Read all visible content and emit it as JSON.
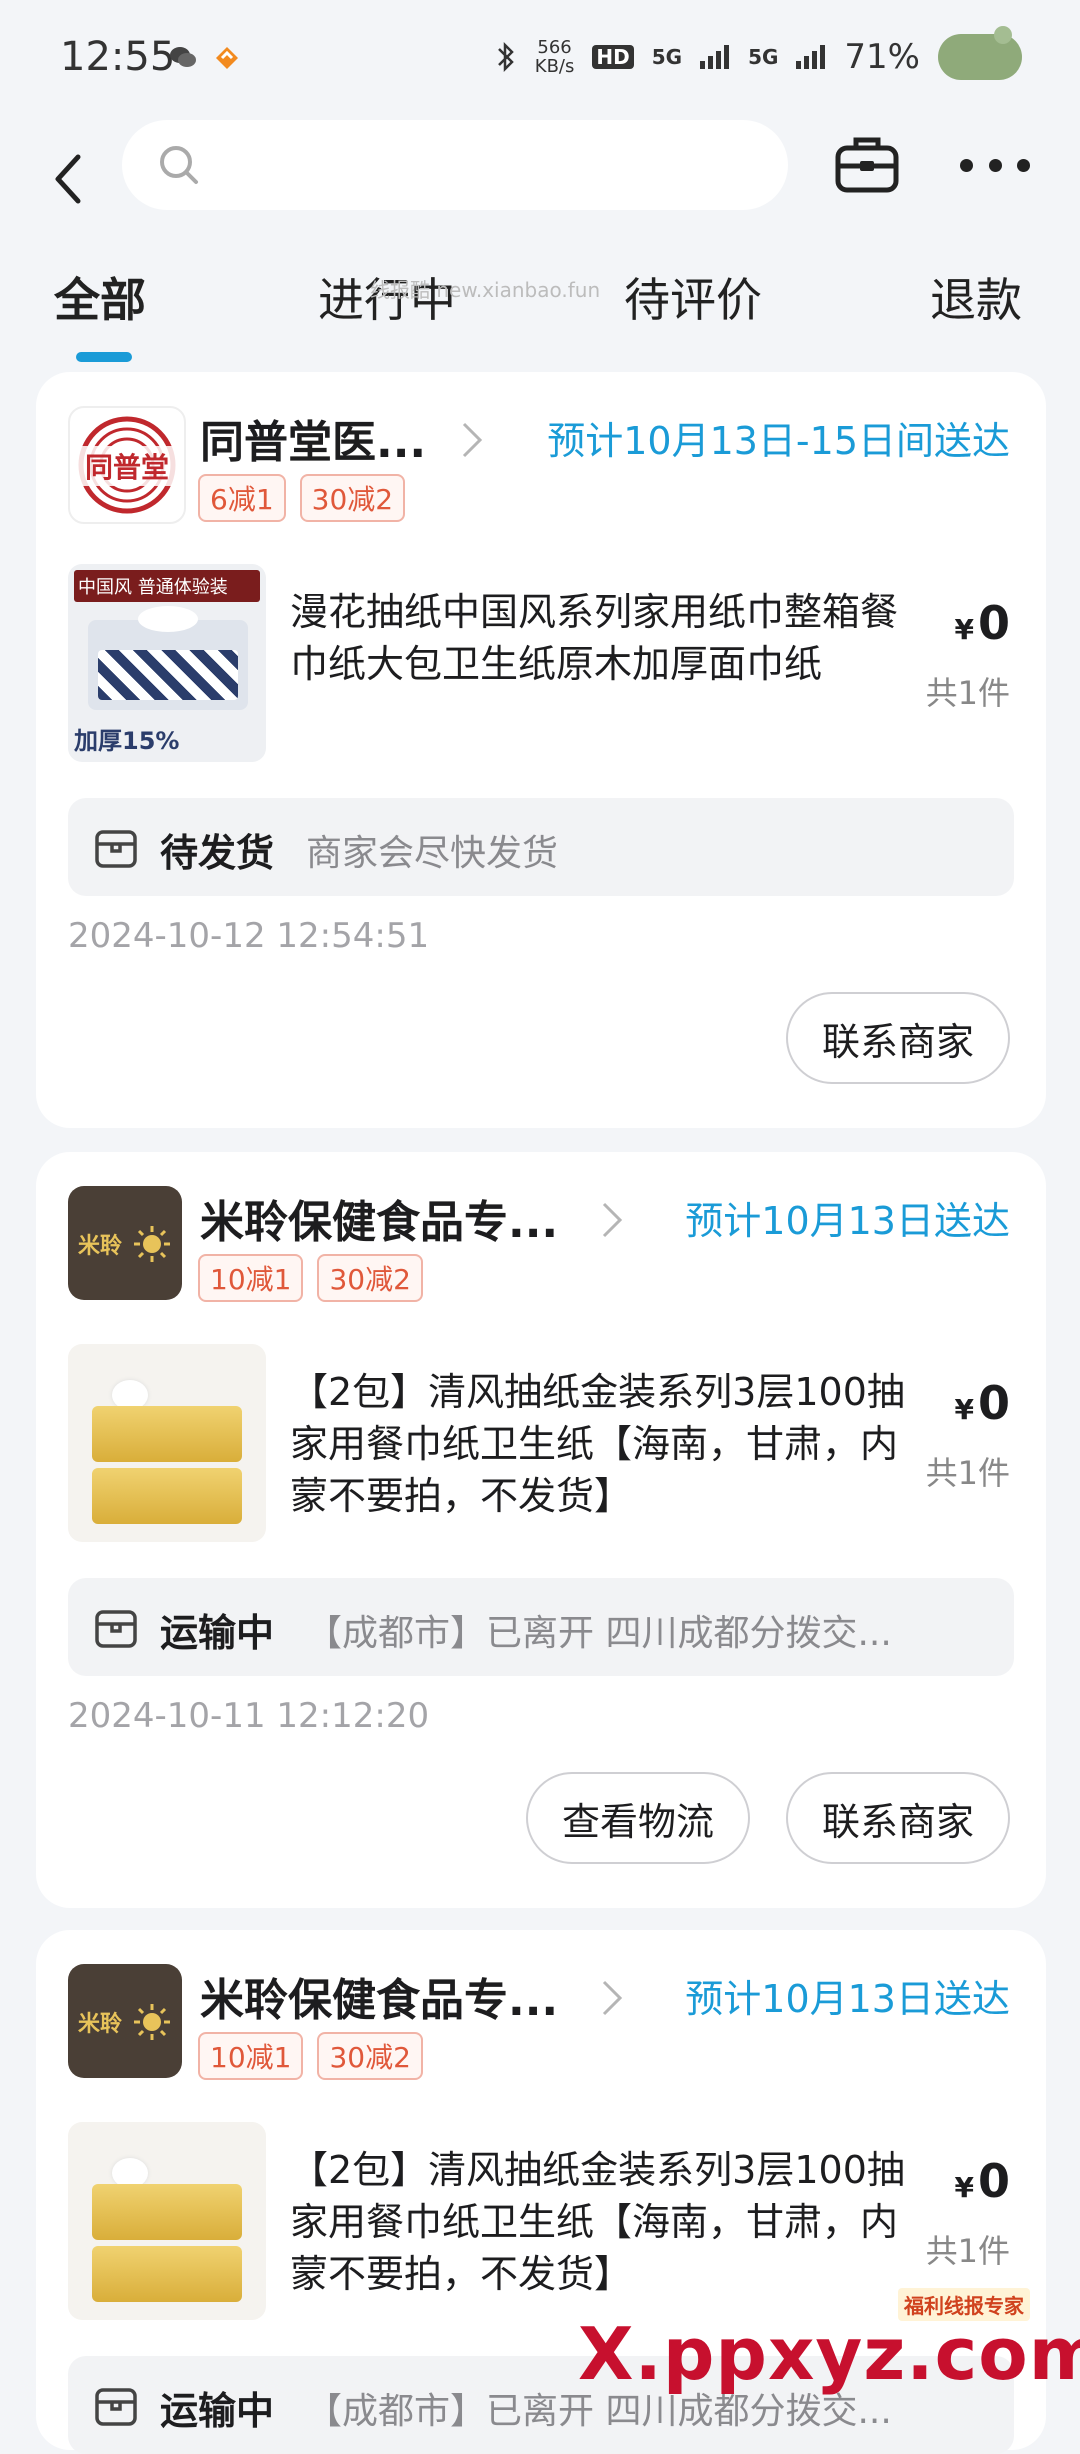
{
  "status_bar": {
    "time": "12:55",
    "net_speed_value": "566",
    "net_speed_unit": "KB/s",
    "hd_label": "HD",
    "signal1": "5G",
    "signal2": "5G",
    "battery": "71%"
  },
  "search": {
    "placeholder": ""
  },
  "tabs": [
    {
      "label": "全部"
    },
    {
      "label": "进行中"
    },
    {
      "label": "待评价"
    },
    {
      "label": "退款"
    }
  ],
  "watermark_top": "线报酷 new.xianbao.fun",
  "orders": [
    {
      "shop_name": "同普堂医...",
      "shop_logo_text": "同普堂",
      "delivery": "预计10月13日-15日间送达",
      "tags": [
        "6减1",
        "30减2"
      ],
      "product_image_label": "中国风 普通体验装",
      "product_image_sub": "加厚15%",
      "product_title": "漫花抽纸中国风系列家用纸巾整箱餐巾纸大包卫生纸原木加厚面巾纸",
      "currency": "¥",
      "price": "0",
      "quantity": "共1件",
      "status_label": "待发货",
      "status_desc": "商家会尽快发货",
      "order_time": "2024-10-12 12:54:51",
      "buttons": [
        "联系商家"
      ]
    },
    {
      "shop_name": "米聆保健食品专...",
      "shop_logo_text": "米聆",
      "delivery": "预计10月13日送达",
      "tags": [
        "10减1",
        "30减2"
      ],
      "product_title": "【2包】清风抽纸金装系列3层100抽家用餐巾纸卫生纸【海南，甘肃，内蒙不要拍，不发货】",
      "currency": "¥",
      "price": "0",
      "quantity": "共1件",
      "status_label": "运输中",
      "status_desc": "【成都市】已离开 四川成都分拨交...",
      "order_time": "2024-10-11 12:12:20",
      "buttons": [
        "查看物流",
        "联系商家"
      ]
    },
    {
      "shop_name": "米聆保健食品专...",
      "shop_logo_text": "米聆",
      "delivery": "预计10月13日送达",
      "tags": [
        "10减1",
        "30减2"
      ],
      "product_title": "【2包】清风抽纸金装系列3层100抽家用餐巾纸卫生纸【海南，甘肃，内蒙不要拍，不发货】",
      "currency": "¥",
      "price": "0",
      "quantity": "共1件",
      "status_label": "运输中",
      "status_desc": "【成都市】已离开 四川成都分拨交..."
    }
  ],
  "bottom_watermark": {
    "tag": "福利线报专家",
    "text": "X.ppxyz.com"
  },
  "colors": {
    "accent_blue": "#1a9bd7",
    "tag_red": "#e0583a",
    "background": "#f3f5f8"
  }
}
